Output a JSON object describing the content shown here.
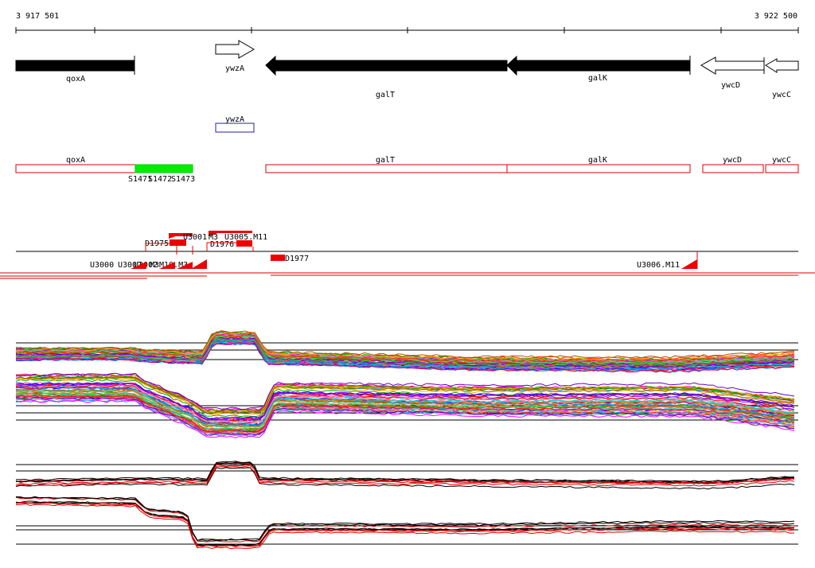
{
  "coordinates": {
    "start": "3 917 501",
    "end": "3 922 500"
  },
  "genes": [
    {
      "name": "qoxA",
      "label": "qoxA",
      "strand": "+",
      "style": "filled"
    },
    {
      "name": "ywzA",
      "label": "ywzA",
      "strand": "+",
      "style": "outline"
    },
    {
      "name": "galT",
      "label": "galT",
      "strand": "-",
      "style": "filled"
    },
    {
      "name": "galK",
      "label": "galK",
      "strand": "-",
      "style": "filled"
    },
    {
      "name": "ywcD",
      "label": "ywcD",
      "strand": "-",
      "style": "outline"
    },
    {
      "name": "ywcC",
      "label": "ywcC",
      "strand": "-",
      "style": "outline"
    }
  ],
  "extra_gene_label": "ywzA",
  "transcripts": [
    {
      "label": "qoxA"
    },
    {
      "label": "galT"
    },
    {
      "label": "galK"
    },
    {
      "label": "ywcD"
    },
    {
      "label": "ywcC"
    }
  ],
  "segments": [
    {
      "label": "S1471"
    },
    {
      "label": "S1472"
    },
    {
      "label": "S1473"
    }
  ],
  "tus": {
    "upper": [
      "D1975",
      "U3001",
      "M3",
      "U3005.M11",
      "D1976"
    ],
    "right": [
      "D1977"
    ],
    "lower": [
      "U3000",
      "U3002",
      "U3002",
      "M3",
      "M10.M3"
    ],
    "far": [
      "U3006.M11"
    ]
  },
  "colors": {
    "filled_gene": "#000000",
    "segment": "#00ee00",
    "transcript": "#dd0000",
    "ywzA_box": "#2222aa",
    "tu": "#ee0000"
  }
}
